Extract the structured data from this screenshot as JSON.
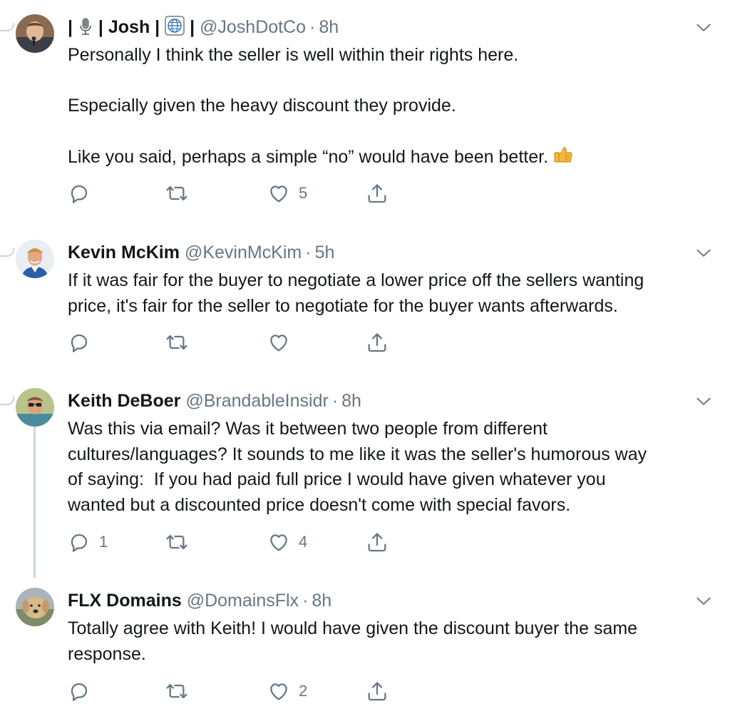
{
  "colors": {
    "text": "#14171a",
    "secondary": "#657786",
    "thread_line": "#ccd6dd"
  },
  "tweets": [
    {
      "name_parts": [
        "|",
        "|",
        "Josh |",
        "|"
      ],
      "name_icons": [
        "microphone-icon",
        "globe-icon"
      ],
      "handle": "@JoshDotCo",
      "separator": "·",
      "time": "8h",
      "lines": [
        "Personally I think the seller is well within their rights here.",
        "",
        "Especially given the heavy discount they provide.",
        "",
        "Like you said, perhaps a simple “no” would have been better."
      ],
      "emoji": "thumbs-up-icon",
      "reply_count": "",
      "retweet_count": "",
      "like_count": "5"
    },
    {
      "name": "Kevin McKim",
      "handle": "@KevinMcKim",
      "separator": "·",
      "time": "5h",
      "lines": [
        "If it was fair for the buyer to negotiate a lower price off the sellers wanting",
        "price, it's fair for the seller to negotiate for the buyer wants afterwards."
      ],
      "reply_count": "",
      "retweet_count": "",
      "like_count": ""
    },
    {
      "name": "Keith DeBoer",
      "handle": "@BrandableInsidr",
      "separator": "·",
      "time": "8h",
      "lines": [
        "Was this via email? Was it between two people from different",
        "cultures/languages? It sounds to me like it was the seller's humorous way",
        "of saying:  If you had paid full price I would have given whatever you",
        "wanted but a discounted price doesn't come with special favors."
      ],
      "reply_count": "1",
      "retweet_count": "",
      "like_count": "4"
    },
    {
      "name": "FLX Domains",
      "handle": "@DomainsFlx",
      "separator": "·",
      "time": "8h",
      "lines": [
        "Totally agree with Keith! I would have given the discount buyer the same",
        "response."
      ],
      "reply_count": "",
      "retweet_count": "",
      "like_count": "2"
    }
  ]
}
